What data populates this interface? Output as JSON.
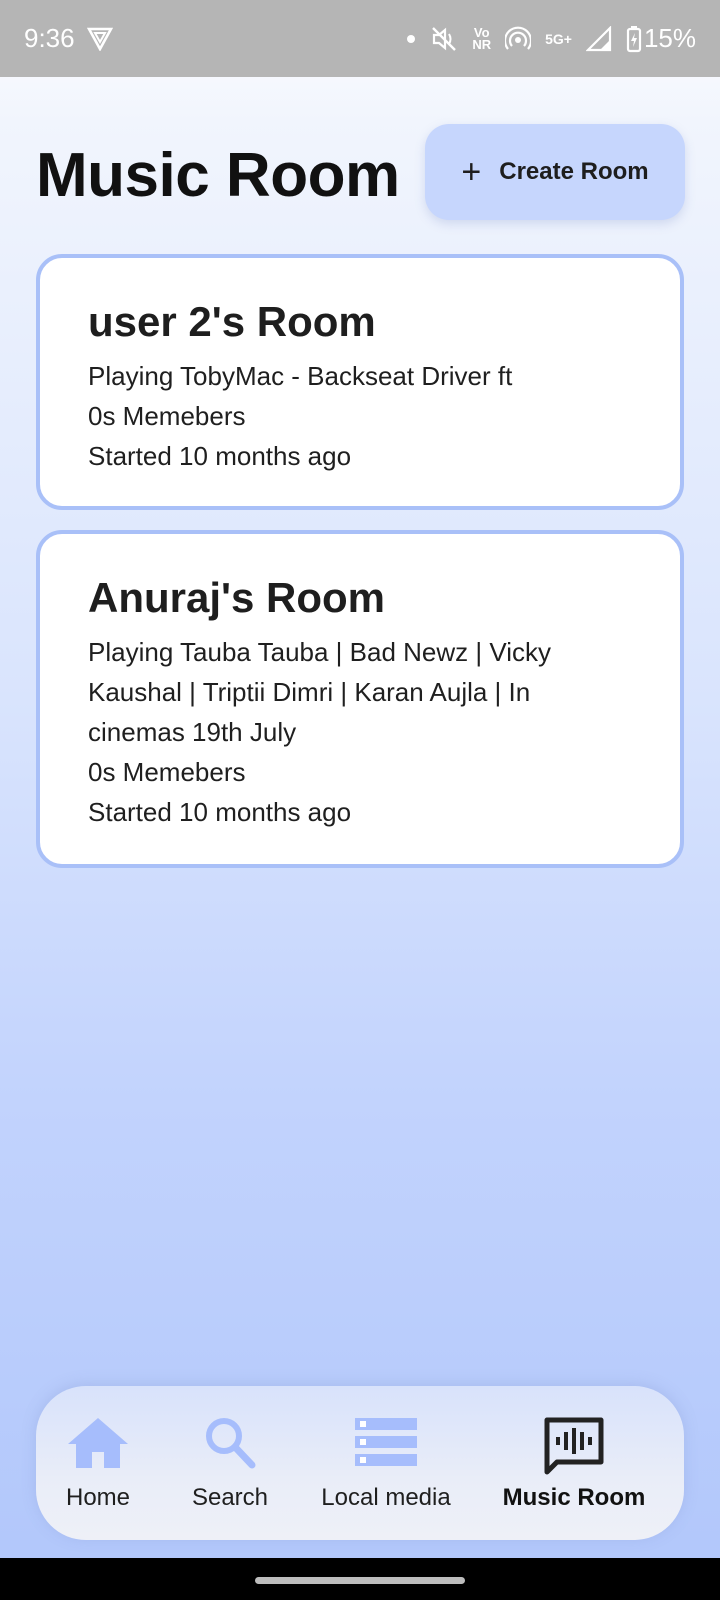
{
  "status_bar": {
    "time": "9:36",
    "volte": "Vo",
    "nr": "NR",
    "network": "5G+",
    "battery": "15%",
    "icons": [
      "vpn-shield-icon",
      "dot-icon",
      "mute-icon",
      "volte-icon",
      "hotspot-icon",
      "signal-icon",
      "battery-charging-icon"
    ]
  },
  "header": {
    "title": "Music Room",
    "create_button": {
      "icon": "plus-icon",
      "plus": "+",
      "label": "Create Room"
    }
  },
  "rooms": [
    {
      "title": "user 2's Room",
      "playing": "Playing TobyMac - Backseat Driver  ft",
      "members": "0s Memebers",
      "started": "Started 10 months ago"
    },
    {
      "title": "Anuraj's Room",
      "playing_lines": [
        "Playing Tauba Tauba | Bad Newz | Vicky",
        "Kaushal | Triptii Dimri | Karan Aujla | In",
        "cinemas 19th July"
      ],
      "members": "0s Memebers",
      "started": "Started 10 months ago"
    }
  ],
  "bottom_nav": {
    "items": [
      {
        "label": "Home",
        "icon": "home-icon",
        "active": false
      },
      {
        "label": "Search",
        "icon": "search-icon",
        "active": false
      },
      {
        "label": "Local media",
        "icon": "storage-icon",
        "active": false
      },
      {
        "label": "Music Room",
        "icon": "music-room-icon",
        "active": true
      }
    ]
  },
  "colors": {
    "accent": "#a6bdfc",
    "card_border": "#a9c0f8",
    "create_button": "#c6d6fd",
    "status_bar": "#b5b5b5"
  }
}
